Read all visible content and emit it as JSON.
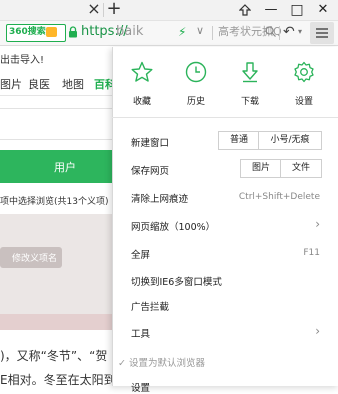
{
  "titlebar": {
    "close_tab": "×",
    "new_tab": "+"
  },
  "window": {
    "minimize": "—",
    "maximize": "□",
    "close": "✕",
    "pin": "⇧"
  },
  "address": {
    "engine": "360搜索",
    "url_prefix": "https://",
    "url_host": "baik",
    "search_text": "高考状元抓Q",
    "accent": "#1fae4f"
  },
  "page": {
    "import_text": "出击导入!",
    "nav": [
      "图片",
      "良医",
      "地图"
    ],
    "nav_active": "百科",
    "green_button": "用户",
    "hint": "项中选择浏览(共13个义项)",
    "chip": "修改义项名",
    "para1": ")，又称“冬节”、“贺",
    "para2": "E相对。冬至在太阳到达"
  },
  "menu": {
    "quick_actions": [
      {
        "label": "收藏",
        "icon": "star-icon"
      },
      {
        "label": "历史",
        "icon": "clock-icon"
      },
      {
        "label": "下载",
        "icon": "download-icon"
      },
      {
        "label": "设置",
        "icon": "gear-icon"
      }
    ],
    "new_window": "新建窗口",
    "new_window_opts": [
      "普通",
      "小号/无痕"
    ],
    "save_page": "保存网页",
    "save_page_opts": [
      "图片",
      "文件"
    ],
    "clear_traces": "清除上网痕迹",
    "clear_shortcut": "Ctrl+Shift+Delete",
    "zoom": "网页缩放（100%）",
    "fullscreen": "全屏",
    "fullscreen_key": "F11",
    "ie6_mode": "切换到IE6多窗口模式",
    "ad_block": "广告拦截",
    "tools": "工具",
    "set_default": "设置为默认浏览器",
    "more": "设置"
  }
}
